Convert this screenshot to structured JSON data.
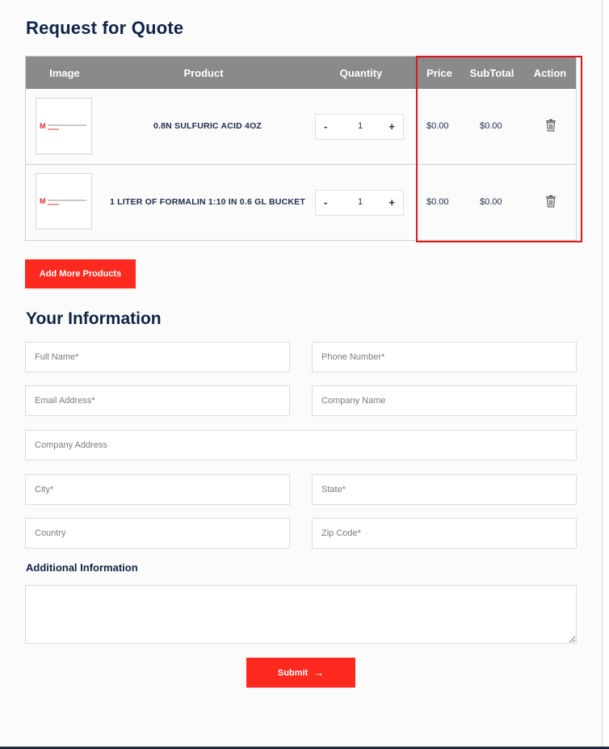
{
  "page": {
    "title": "Request for Quote",
    "section_title": "Your Information",
    "additional_label": "Additional Information"
  },
  "table": {
    "headers": [
      "Image",
      "Product",
      "Quantity",
      "Price",
      "SubTotal",
      "Action"
    ],
    "rows": [
      {
        "product": "0.8N SULFURIC ACID 4OZ",
        "quantity": "1",
        "price": "$0.00",
        "subtotal": "$0.00"
      },
      {
        "product": "1 LITER OF FORMALIN 1:10 IN 0.6 GL BUCKET",
        "quantity": "1",
        "price": "$0.00",
        "subtotal": "$0.00"
      }
    ],
    "minus": "-",
    "plus": "+",
    "action_icon": "trash-icon",
    "logo_letter": "M"
  },
  "buttons": {
    "add_more": "Add More Products",
    "submit": "Submit",
    "submit_icon": "→"
  },
  "form": {
    "full_name": "Full Name*",
    "phone": "Phone Number*",
    "email": "Email Address*",
    "company_name": "Company Name",
    "company_address": "Company Address",
    "city": "City*",
    "state": "State*",
    "country": "Country",
    "zip": "Zip Code*"
  },
  "colors": {
    "accent": "#ff2a1f",
    "header_gray": "#8a8a8a",
    "highlight": "#e01616",
    "heading": "#0f2444"
  }
}
